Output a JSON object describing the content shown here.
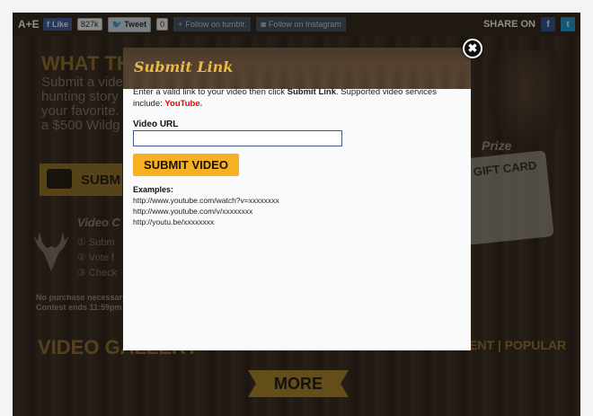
{
  "topbar": {
    "logo": "A+E",
    "fb_like_label": "Like",
    "fb_like_count": "827k",
    "tweet_label": "Tweet",
    "tweet_count": "0",
    "follow_tumblr": "Follow on tumblr.",
    "follow_instagram": "Follow on Instagram",
    "share_label": "SHARE ON",
    "share_fb_icon": "f",
    "share_tw_icon": "t"
  },
  "background": {
    "heading": "WHAT TH",
    "intro_lines": [
      "Submit a vide",
      "hunting story",
      "your favorite.",
      "a $500 Wildg"
    ],
    "submit_label": "SUBM",
    "video_contest_label": "Video C",
    "steps": [
      "① Subm",
      "② Vote f",
      "③ Check"
    ],
    "fine_print": [
      "No purchase necessary",
      "Contest ends 11:59pm"
    ],
    "prize_label": "Prize",
    "gift_card_label": "GIFT CARD",
    "gallery_heading": "VIDEO GALLERY",
    "gallery_tabs": "ENT  |  POPULAR",
    "more_label": "MORE"
  },
  "modal": {
    "title": "Submit Link",
    "desc_part1": "Enter a valid link to your video then click ",
    "desc_bold": "Submit Link",
    "desc_part2": ". Supported video services include: ",
    "desc_service": "YouTube",
    "desc_end": ".",
    "field_label": "Video URL",
    "field_value": "",
    "field_placeholder": "",
    "submit_label": "SUBMIT VIDEO",
    "examples_label": "Examples:",
    "examples": [
      "http://www.youtube.com/watch?v=xxxxxxxx",
      "http://www.youtube.com/v/xxxxxxxx",
      "http://youtu.be/xxxxxxxx"
    ],
    "close_icon": "✖"
  },
  "colors": {
    "accent": "#f5b023",
    "wood": "#3b2e22",
    "title_gold": "#e9b94a",
    "youtube_red": "#ee0000"
  }
}
